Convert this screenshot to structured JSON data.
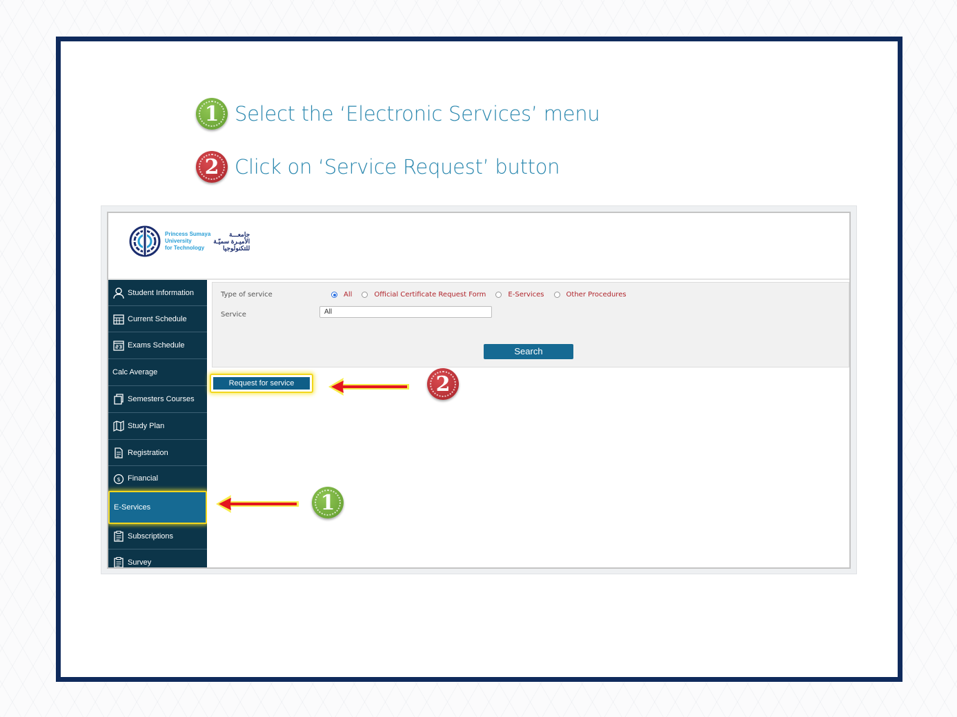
{
  "instructions": [
    {
      "step": "1",
      "text": "Select the ‘Electronic Services’ menu"
    },
    {
      "step": "2",
      "text": "Click on ‘Service Request’ button"
    }
  ],
  "logo": {
    "en_line1": "Princess Sumaya",
    "en_line2": "University",
    "en_line3": "for Technology",
    "ar_line1": "جامعـــة",
    "ar_line2": "الأميـرة سميّـة",
    "ar_line3": "للتكنولوجيا"
  },
  "sidebar": {
    "items": [
      {
        "label": "Student Information",
        "icon": "user-icon"
      },
      {
        "label": "Current Schedule",
        "icon": "calendar-icon"
      },
      {
        "label": "Exams Schedule",
        "icon": "calendar-23-icon"
      },
      {
        "label": "Calc Average",
        "icon": ""
      },
      {
        "label": "Semesters Courses",
        "icon": "copy-icon"
      },
      {
        "label": "Study Plan",
        "icon": "map-icon"
      },
      {
        "label": "Registration",
        "icon": "document-icon"
      },
      {
        "label": "Financial",
        "icon": "dollar-icon"
      },
      {
        "label": "E-Services",
        "icon": ""
      },
      {
        "label": "Subscriptions",
        "icon": "clipboard-icon"
      },
      {
        "label": "Survey",
        "icon": "clipboard-icon"
      }
    ],
    "active_index": 8
  },
  "filter": {
    "type_label": "Type of service",
    "service_label": "Service",
    "radios": [
      "All",
      "Official Certificate Request Form",
      "E-Services",
      "Other Procedures"
    ],
    "selected_radio": "All",
    "service_value": "All",
    "search_label": "Search"
  },
  "request_button": {
    "label": "Request for service"
  },
  "colors": {
    "frame": "#0f2a5c",
    "instruction_text": "#2a87ae",
    "sidebar_bg": "#0c3549",
    "sidebar_active": "#166a93",
    "highlight": "#f2d61d",
    "badge_green": "#6fae3a",
    "badge_red": "#b8313a",
    "arrow": "#e3151f"
  }
}
